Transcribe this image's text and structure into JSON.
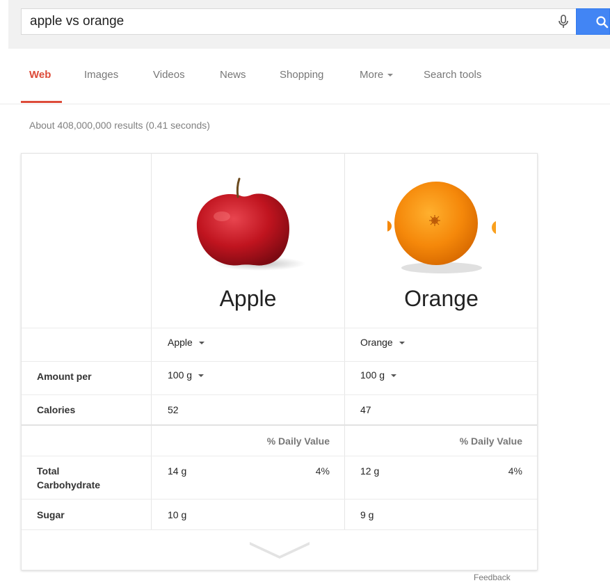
{
  "search": {
    "query": "apple vs orange"
  },
  "tabs": [
    {
      "label": "Web",
      "active": true
    },
    {
      "label": "Images",
      "active": false
    },
    {
      "label": "Videos",
      "active": false
    },
    {
      "label": "News",
      "active": false
    },
    {
      "label": "Shopping",
      "active": false
    },
    {
      "label": "More",
      "active": false
    },
    {
      "label": "Search tools",
      "active": false
    }
  ],
  "results_stats": "About 408,000,000 results (0.41 seconds)",
  "comparison": {
    "fruits": [
      {
        "name": "Apple",
        "selector": "Apple",
        "amount": "100 g",
        "calories": "52",
        "carb": "14 g",
        "carb_dv": "4%",
        "sugar": "10 g"
      },
      {
        "name": "Orange",
        "selector": "Orange",
        "amount": "100 g",
        "calories": "47",
        "carb": "12 g",
        "carb_dv": "4%",
        "sugar": "9 g"
      }
    ],
    "row_labels": {
      "amount": "Amount per",
      "calories": "Calories",
      "carb_line1": "Total",
      "carb_line2": "Carbohydrate",
      "sugar": "Sugar"
    },
    "daily_value_header": "% Daily Value"
  },
  "feedback_label": "Feedback",
  "colors": {
    "accent_red": "#dd4b39",
    "search_blue": "#4285f4"
  },
  "icons": {
    "mic": "microphone-icon",
    "search": "magnifier-icon",
    "expand": "chevron-down-icon"
  }
}
